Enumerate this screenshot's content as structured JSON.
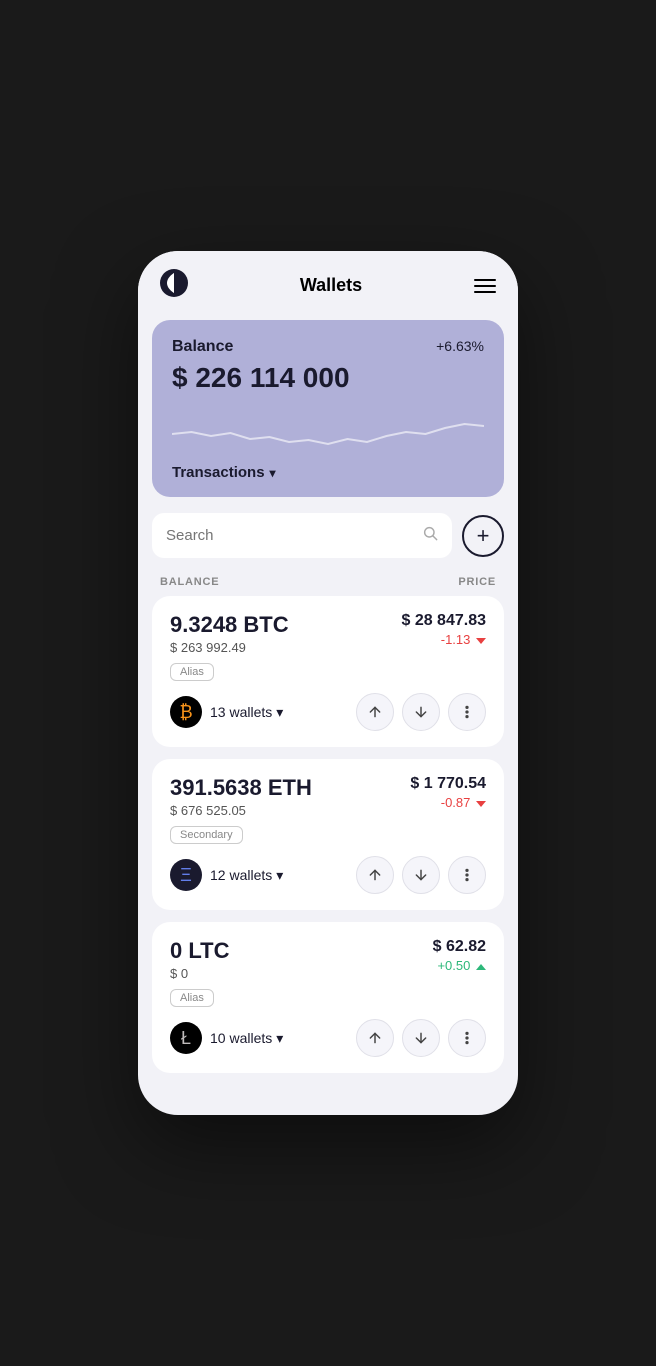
{
  "header": {
    "title": "Wallets",
    "menu_label": "menu"
  },
  "balance_card": {
    "label": "Balance",
    "amount": "$ 226 114 000",
    "change": "+6.63%",
    "transactions_label": "Transactions"
  },
  "search": {
    "placeholder": "Search",
    "add_label": "+"
  },
  "list_headers": {
    "balance": "BALANCE",
    "price": "PRICE"
  },
  "coins": [
    {
      "amount": "9.3248 BTC",
      "fiat": "$ 263 992.49",
      "price": "$ 28 847.83",
      "change": "-1.13",
      "change_dir": "down",
      "tag": "Alias",
      "wallets": "13 wallets",
      "logo_type": "btc",
      "logo_symbol": "₿"
    },
    {
      "amount": "391.5638 ETH",
      "fiat": "$ 676 525.05",
      "price": "$ 1 770.54",
      "change": "-0.87",
      "change_dir": "down",
      "tag": "Secondary",
      "wallets": "12 wallets",
      "logo_type": "eth",
      "logo_symbol": "Ξ"
    },
    {
      "amount": "0 LTC",
      "fiat": "$ 0",
      "price": "$ 62.82",
      "change": "+0.50",
      "change_dir": "up",
      "tag": "Alias",
      "wallets": "10 wallets",
      "logo_type": "ltc",
      "logo_symbol": "Ł"
    }
  ],
  "colors": {
    "accent": "#b0b0d8",
    "dark": "#1a1a2e",
    "down": "#e84040",
    "up": "#2db87a"
  }
}
